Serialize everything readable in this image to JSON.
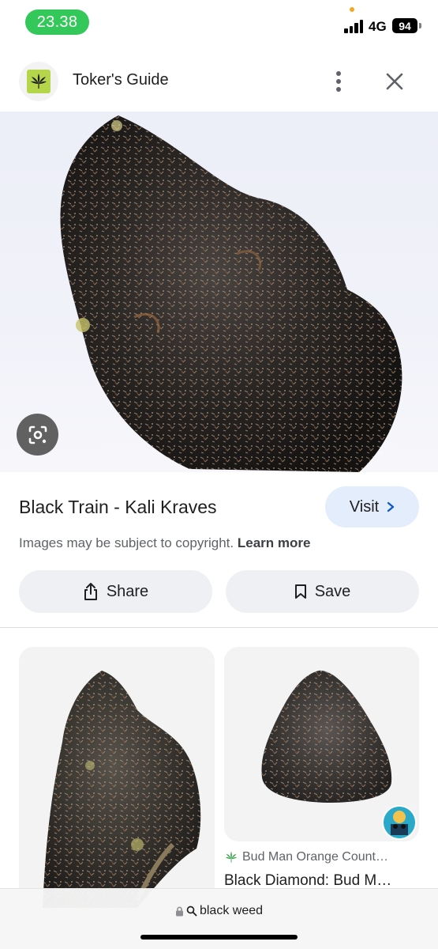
{
  "status_bar": {
    "time": "23.38",
    "network": "4G",
    "battery": "94"
  },
  "header": {
    "site_name": "Toker's Guide",
    "logo_icon": "cannabis-leaf-icon",
    "more_icon": "more-vert-icon",
    "close_icon": "close-icon"
  },
  "image": {
    "lens_icon": "google-lens-icon"
  },
  "details": {
    "title": "Black Train - Kali Kraves",
    "visit_label": "Visit",
    "copyright_text": "Images may be subject to copyright.",
    "learn_more": "Learn more",
    "share_label": "Share",
    "save_label": "Save"
  },
  "related": {
    "right_card": {
      "source": "Bud Man Orange Count…",
      "title": "Black Diamond: Bud M…"
    }
  },
  "url_bar": {
    "query": "black weed"
  },
  "colors": {
    "status_pill": "#34c759",
    "visit_bg": "#e3edfb",
    "accent_blue": "#0b57d0",
    "button_bg": "#eef0f4"
  }
}
